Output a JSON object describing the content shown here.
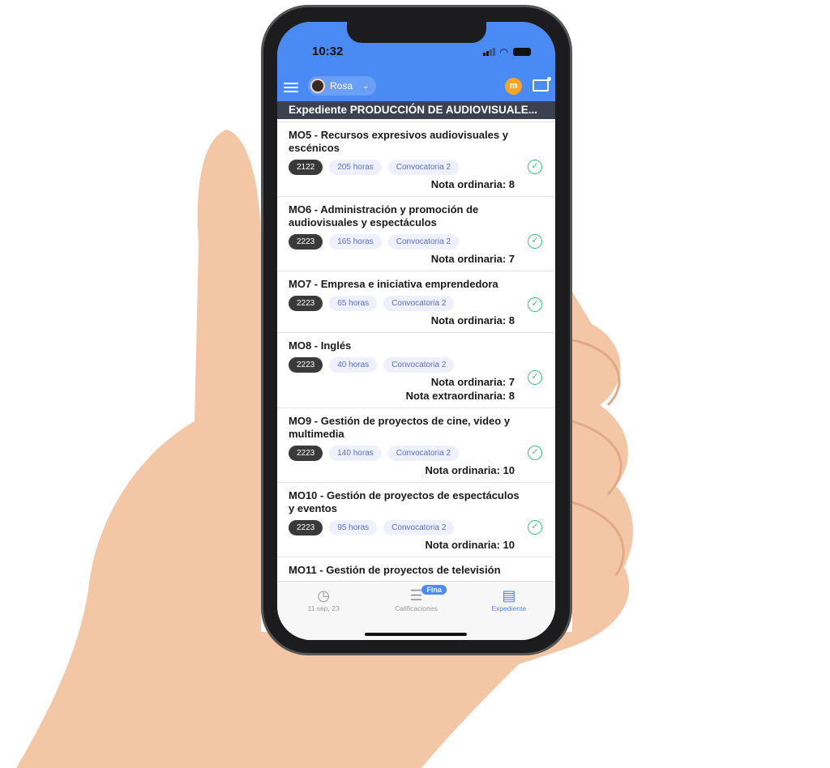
{
  "status": {
    "time": "10:32"
  },
  "header": {
    "user": "Rosa",
    "brand_icon": "m",
    "banner": "Expediente PRODUCCIÓN DE AUDIOVISUALE..."
  },
  "items": [
    {
      "title": "MO5 - Recursos expresivos audiovisuales y escénicos",
      "year": "2122",
      "hours": "205 horas",
      "call": "Convocatoria 2",
      "notes": [
        "Nota ordinaria: 8"
      ]
    },
    {
      "title": "MO6 - Administración y promoción de audiovisuales y espectáculos",
      "year": "2223",
      "hours": "165 horas",
      "call": "Convocatoria 2",
      "notes": [
        "Nota ordinaria: 7"
      ]
    },
    {
      "title": "MO7 - Empresa e iniciativa emprendedora",
      "year": "2223",
      "hours": "65 horas",
      "call": "Convocatoria 2",
      "notes": [
        "Nota ordinaria: 8"
      ]
    },
    {
      "title": "MO8 - Inglés",
      "year": "2223",
      "hours": "40 horas",
      "call": "Convocatoria 2",
      "notes": [
        "Nota ordinaria: 7",
        "Nota extraordinaria: 8"
      ]
    },
    {
      "title": "MO9 - Gestión de proyectos de cine, video y multimedia",
      "year": "2223",
      "hours": "140 horas",
      "call": "Convocatoria 2",
      "notes": [
        "Nota ordinaria: 10"
      ]
    },
    {
      "title": "MO10 - Gestión de proyectos de espectáculos y eventos",
      "year": "2223",
      "hours": "95 horas",
      "call": "Convocatoria 2",
      "notes": [
        "Nota ordinaria: 10"
      ]
    },
    {
      "title": "MO11 - Gestión de proyectos de televisión",
      "year": "",
      "hours": "",
      "call": "",
      "notes": []
    }
  ],
  "tabs": [
    {
      "label": "11 sep, 23",
      "icon": "clock-icon"
    },
    {
      "label": "Calificaciones",
      "icon": "list-icon",
      "badge": "Fina"
    },
    {
      "label": "Expediente",
      "icon": "inbox-icon",
      "active": true
    }
  ],
  "colors": {
    "accent": "#4a8af4",
    "banner": "#3c4150",
    "check": "#3cc37a"
  }
}
